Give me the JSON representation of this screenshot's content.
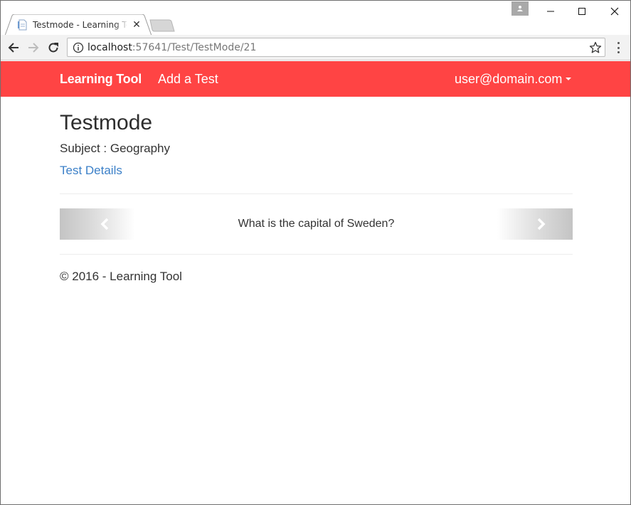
{
  "browser": {
    "tab_title": "Testmode - Learning Tool",
    "tab_close": "✕",
    "url_host": "localhost",
    "url_rest": ":57641/Test/TestMode/21"
  },
  "navbar": {
    "brand": "Learning Tool",
    "add_test": "Add a Test",
    "user": "user@domain.com",
    "bg_color": "#ff4444"
  },
  "page": {
    "title": "Testmode",
    "subject": "Subject : Geography",
    "details_link": "Test Details",
    "link_color": "#3c80c8"
  },
  "carousel": {
    "question": "What is the capital of Sweden?",
    "prev_icon": "chevron-left-icon",
    "next_icon": "chevron-right-icon"
  },
  "footer": {
    "text": "© 2016 - Learning Tool"
  }
}
